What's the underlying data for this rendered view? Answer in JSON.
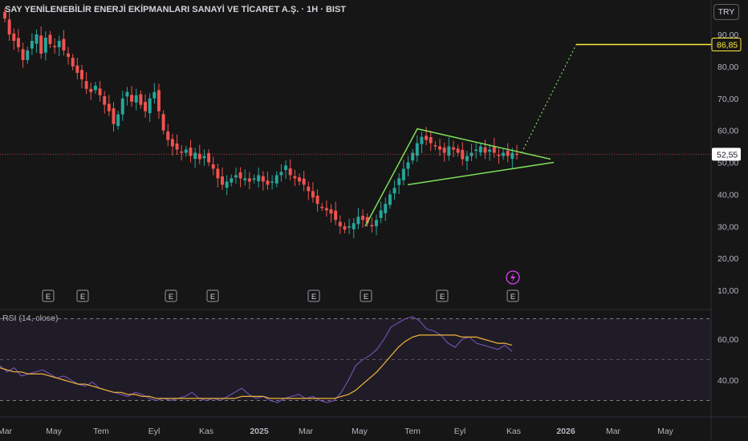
{
  "title": "SAY YENİLENEBİLİR ENERJİ EKİPMANLARI SANAYİ VE TİCARET A.Ş. · 1H · BIST",
  "currency": "TRY",
  "rsi_title": "RSI (14, close)",
  "colors": {
    "up": "#26a69a",
    "down": "#ef5350",
    "pattern": "#7ee05a",
    "target": "#ffeb3b",
    "rsi": "#7e57c2",
    "rsi_ma": "#f0b43a",
    "bg": "#161616"
  },
  "icons": {
    "earnings": "earnings-e-icon",
    "dividend": "lightning-icon"
  },
  "chart_data": [
    {
      "type": "candlestick",
      "name": "price",
      "ylim": [
        5,
        98
      ],
      "y_ticks": [
        "90,00",
        "80,00",
        "70,00",
        "60,00",
        "50,00",
        "40,00",
        "30,00",
        "20,00",
        "10,00"
      ],
      "y_tick_values": [
        90,
        80,
        70,
        60,
        50,
        40,
        30,
        20,
        10
      ],
      "x_ticks": [
        "Mar",
        "May",
        "Tem",
        "Eyl",
        "Kas",
        "2025",
        "Mar",
        "May",
        "Tem",
        "Eyl",
        "Kas",
        "2026",
        "Mar",
        "May"
      ],
      "last_price_label": "52,55",
      "last_price": 52.55,
      "target_label": "86,85",
      "target_price": 86.85,
      "closes": [
        95,
        90,
        88,
        86,
        82,
        85,
        88,
        90,
        84,
        89,
        87,
        86,
        88,
        85,
        83,
        80,
        78,
        76,
        73,
        72,
        74,
        71,
        68,
        66,
        62,
        65,
        70,
        72,
        69,
        71,
        68,
        66,
        70,
        72,
        66,
        60,
        57,
        55,
        54,
        53,
        54,
        52,
        53,
        51,
        52,
        50,
        48,
        45,
        43,
        44,
        45,
        46,
        45,
        45,
        44,
        45,
        46,
        44,
        43,
        44,
        46,
        47,
        49,
        46,
        45,
        44,
        43,
        41,
        39,
        37,
        36,
        35,
        34,
        32,
        30,
        29,
        30,
        31,
        33,
        32,
        31,
        30,
        32,
        35,
        37,
        40,
        42,
        45,
        48,
        50,
        53,
        56,
        58,
        57,
        56,
        55,
        54,
        53,
        55,
        54,
        53,
        51,
        52,
        53,
        54,
        55,
        53,
        54,
        53,
        52,
        53,
        52,
        53,
        52.5
      ],
      "earnings_markers": 8,
      "pattern": "symmetrical-triangle"
    },
    {
      "type": "line",
      "name": "RSI",
      "ylim": [
        28,
        75
      ],
      "y_ticks": [
        "60,00",
        "40,00"
      ],
      "y_tick_values": [
        60,
        40
      ],
      "series": [
        {
          "name": "RSI",
          "values": [
            47,
            44,
            46,
            42,
            43,
            44,
            45,
            43,
            41,
            42,
            40,
            38,
            37,
            39,
            36,
            35,
            34,
            33,
            32,
            34,
            33,
            31,
            30,
            31,
            30,
            31,
            32,
            34,
            31,
            30,
            31,
            30,
            32,
            34,
            36,
            33,
            31,
            32,
            30,
            29,
            31,
            32,
            33,
            31,
            32,
            30,
            29,
            30,
            34,
            40,
            47,
            50,
            52,
            55,
            60,
            66,
            68,
            70,
            71,
            69,
            65,
            64,
            62,
            58,
            56,
            60,
            61,
            58,
            57,
            56,
            55,
            57,
            54
          ]
        },
        {
          "name": "MA",
          "values": [
            46,
            45,
            44,
            44,
            43,
            43,
            43,
            42,
            41,
            40,
            39,
            38,
            38,
            37,
            36,
            35,
            34,
            34,
            33,
            33,
            32,
            32,
            31,
            31,
            31,
            31,
            31,
            31,
            31,
            31,
            31,
            31,
            31,
            31,
            32,
            32,
            32,
            32,
            31,
            31,
            31,
            31,
            31,
            31,
            31,
            31,
            31,
            31,
            32,
            33,
            35,
            38,
            41,
            44,
            48,
            52,
            56,
            59,
            61,
            62,
            62,
            62,
            62,
            62,
            62,
            61,
            61,
            61,
            60,
            59,
            58,
            58,
            57
          ]
        }
      ]
    }
  ]
}
